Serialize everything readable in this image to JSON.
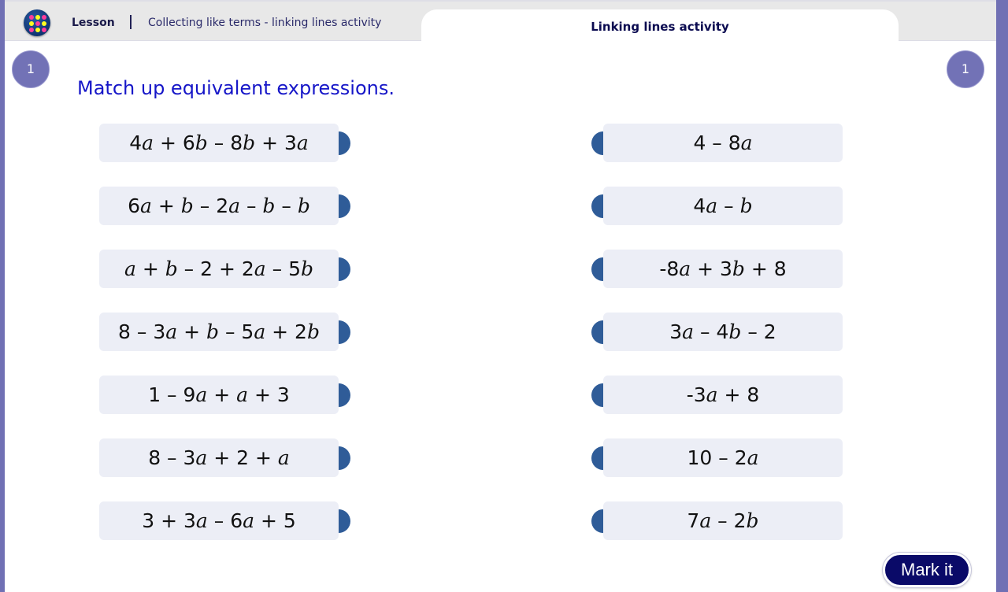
{
  "header": {
    "logo_icon": "app-logo-dots-icon",
    "lesson_label": "Lesson",
    "breadcrumb_title": "Collecting like terms - linking lines activity",
    "active_tab_label": "Linking lines activity"
  },
  "badges": {
    "left_number": "1",
    "right_number": "1"
  },
  "activity": {
    "instruction": "Match up equivalent expressions.",
    "left_expressions": [
      [
        {
          "t": "4"
        },
        {
          "v": "a"
        },
        {
          "t": " + 6"
        },
        {
          "v": "b"
        },
        {
          "t": " – 8"
        },
        {
          "v": "b"
        },
        {
          "t": " + 3"
        },
        {
          "v": "a"
        }
      ],
      [
        {
          "t": "6"
        },
        {
          "v": "a"
        },
        {
          "t": " + "
        },
        {
          "v": "b"
        },
        {
          "t": " – 2"
        },
        {
          "v": "a"
        },
        {
          "t": " – "
        },
        {
          "v": "b"
        },
        {
          "t": " – "
        },
        {
          "v": "b"
        }
      ],
      [
        {
          "v": "a"
        },
        {
          "t": " + "
        },
        {
          "v": "b"
        },
        {
          "t": " – 2 + 2"
        },
        {
          "v": "a"
        },
        {
          "t": " – 5"
        },
        {
          "v": "b"
        }
      ],
      [
        {
          "t": "8 – 3"
        },
        {
          "v": "a"
        },
        {
          "t": " + "
        },
        {
          "v": "b"
        },
        {
          "t": " – 5"
        },
        {
          "v": "a"
        },
        {
          "t": " + 2"
        },
        {
          "v": "b"
        }
      ],
      [
        {
          "t": "1 – 9"
        },
        {
          "v": "a"
        },
        {
          "t": " + "
        },
        {
          "v": "a"
        },
        {
          "t": " + 3"
        }
      ],
      [
        {
          "t": "8 – 3"
        },
        {
          "v": "a"
        },
        {
          "t": " + 2 + "
        },
        {
          "v": "a"
        }
      ],
      [
        {
          "t": "3 + 3"
        },
        {
          "v": "a"
        },
        {
          "t": " – 6"
        },
        {
          "v": "a"
        },
        {
          "t": " + 5"
        }
      ]
    ],
    "right_expressions": [
      [
        {
          "t": "4 – 8"
        },
        {
          "v": "a"
        }
      ],
      [
        {
          "t": "4"
        },
        {
          "v": "a"
        },
        {
          "t": " – "
        },
        {
          "v": "b"
        }
      ],
      [
        {
          "t": "-8"
        },
        {
          "v": "a"
        },
        {
          "t": " + 3"
        },
        {
          "v": "b"
        },
        {
          "t": " + 8"
        }
      ],
      [
        {
          "t": "3"
        },
        {
          "v": "a"
        },
        {
          "t": " – 4"
        },
        {
          "v": "b"
        },
        {
          "t": " – 2"
        }
      ],
      [
        {
          "t": "-3"
        },
        {
          "v": "a"
        },
        {
          "t": " + 8"
        }
      ],
      [
        {
          "t": "10 – 2"
        },
        {
          "v": "a"
        }
      ],
      [
        {
          "t": "7"
        },
        {
          "v": "a"
        },
        {
          "t": " – 2"
        },
        {
          "v": "b"
        }
      ]
    ],
    "left_plain": [
      "4a + 6b – 8b + 3a",
      "6a + b – 2a – b – b",
      "a + b – 2 + 2a – 5b",
      "8 – 3a + b – 5a + 2b",
      "1 – 9a + a + 3",
      "8 – 3a + 2 + a",
      "3 + 3a – 6a + 5"
    ],
    "right_plain": [
      "4 – 8a",
      "4a – b",
      "-8a + 3b + 8",
      "3a – 4b – 2",
      "-3a + 8",
      "10 – 2a",
      "7a – 2b"
    ]
  },
  "actions": {
    "mark_label": "Mark it"
  },
  "colors": {
    "frame": "#7070b4",
    "instruction": "#1616c8",
    "card_bg": "#eceef6",
    "connector": "#2f5c98",
    "mark_button": "#0a0a68"
  }
}
